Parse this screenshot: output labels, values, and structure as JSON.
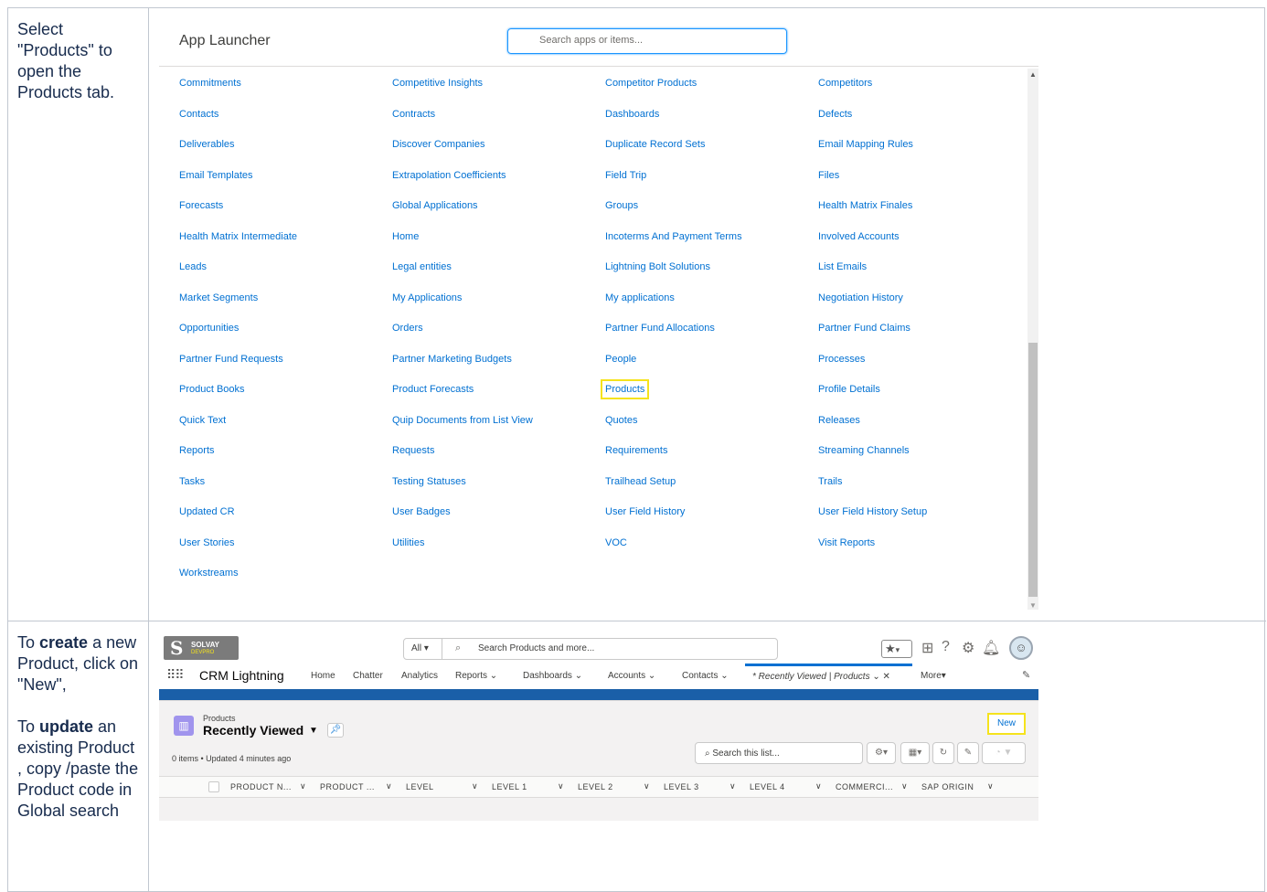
{
  "rows": [
    {
      "instruction": [
        {
          "text": "Select \"Products\" to open the Products tab.",
          "bold": false
        }
      ]
    },
    {
      "instruction_parts": [
        "To ",
        "create",
        " a new Product, click on \"New\",",
        "To ",
        "update",
        " an existing Product , copy /paste the Product code in Global search"
      ]
    }
  ],
  "launcher": {
    "title": "App Launcher",
    "search_placeholder": "Search apps or items...",
    "columns": [
      [
        "Commitments",
        "Contacts",
        "Deliverables",
        "Email Templates",
        "Forecasts",
        "Health Matrix Intermediate",
        "Leads",
        "Market Segments",
        "Opportunities",
        "Partner Fund Requests",
        "Product Books",
        "Quick Text",
        "Reports",
        "Tasks",
        "Updated CR",
        "User Stories",
        "Workstreams"
      ],
      [
        "Competitive Insights",
        "Contracts",
        "Discover Companies",
        "Extrapolation Coefficients",
        "Global Applications",
        "Home",
        "Legal entities",
        "My Applications",
        "Orders",
        "Partner Marketing Budgets",
        "Product Forecasts",
        "Quip Documents from List View",
        "Requests",
        "Testing Statuses",
        "User Badges",
        "Utilities"
      ],
      [
        "Competitor Products",
        "Dashboards",
        "Duplicate Record Sets",
        "Field Trip",
        "Groups",
        "Incoterms And Payment Terms",
        "Lightning Bolt Solutions",
        "My applications",
        "Partner Fund Allocations",
        "People",
        "Products",
        "Quotes",
        "Requirements",
        "Trailhead Setup",
        "User Field History",
        "VOC"
      ],
      [
        "Competitors",
        "Defects",
        "Email Mapping Rules",
        "Files",
        "Health Matrix Finales",
        "Involved Accounts",
        "List Emails",
        "Negotiation History",
        "Partner Fund Claims",
        "Processes",
        "Profile Details",
        "Releases",
        "Streaming Channels",
        "Trails",
        "User Field History Setup",
        "Visit Reports"
      ]
    ],
    "highlighted_item": "Products",
    "highlight_color": "#f5e31d",
    "link_color": "#0070d2"
  },
  "salesforce": {
    "logo_text": "SOLVAY",
    "logo_sub": "DEVPRO",
    "search_scope": "All",
    "search_placeholder": "Search Products and more...",
    "app_name": "CRM Lightning",
    "nav_items": [
      "Home",
      "Chatter",
      "Analytics",
      "Reports",
      "Dashboards",
      "Accounts",
      "Contacts"
    ],
    "active_tab": "* Recently Viewed | Products",
    "more_label": "More",
    "object_label": "Products",
    "view_name": "Recently Viewed",
    "new_button": "New",
    "meta": "0 items • Updated 4 minutes ago",
    "list_search_placeholder": "Search this list...",
    "columns": [
      "PRODUCT N...",
      "PRODUCT ...",
      "LEVEL",
      "LEVEL 1",
      "LEVEL 2",
      "LEVEL 3",
      "LEVEL 4",
      "COMMERCI...",
      "SAP ORIGIN"
    ]
  }
}
